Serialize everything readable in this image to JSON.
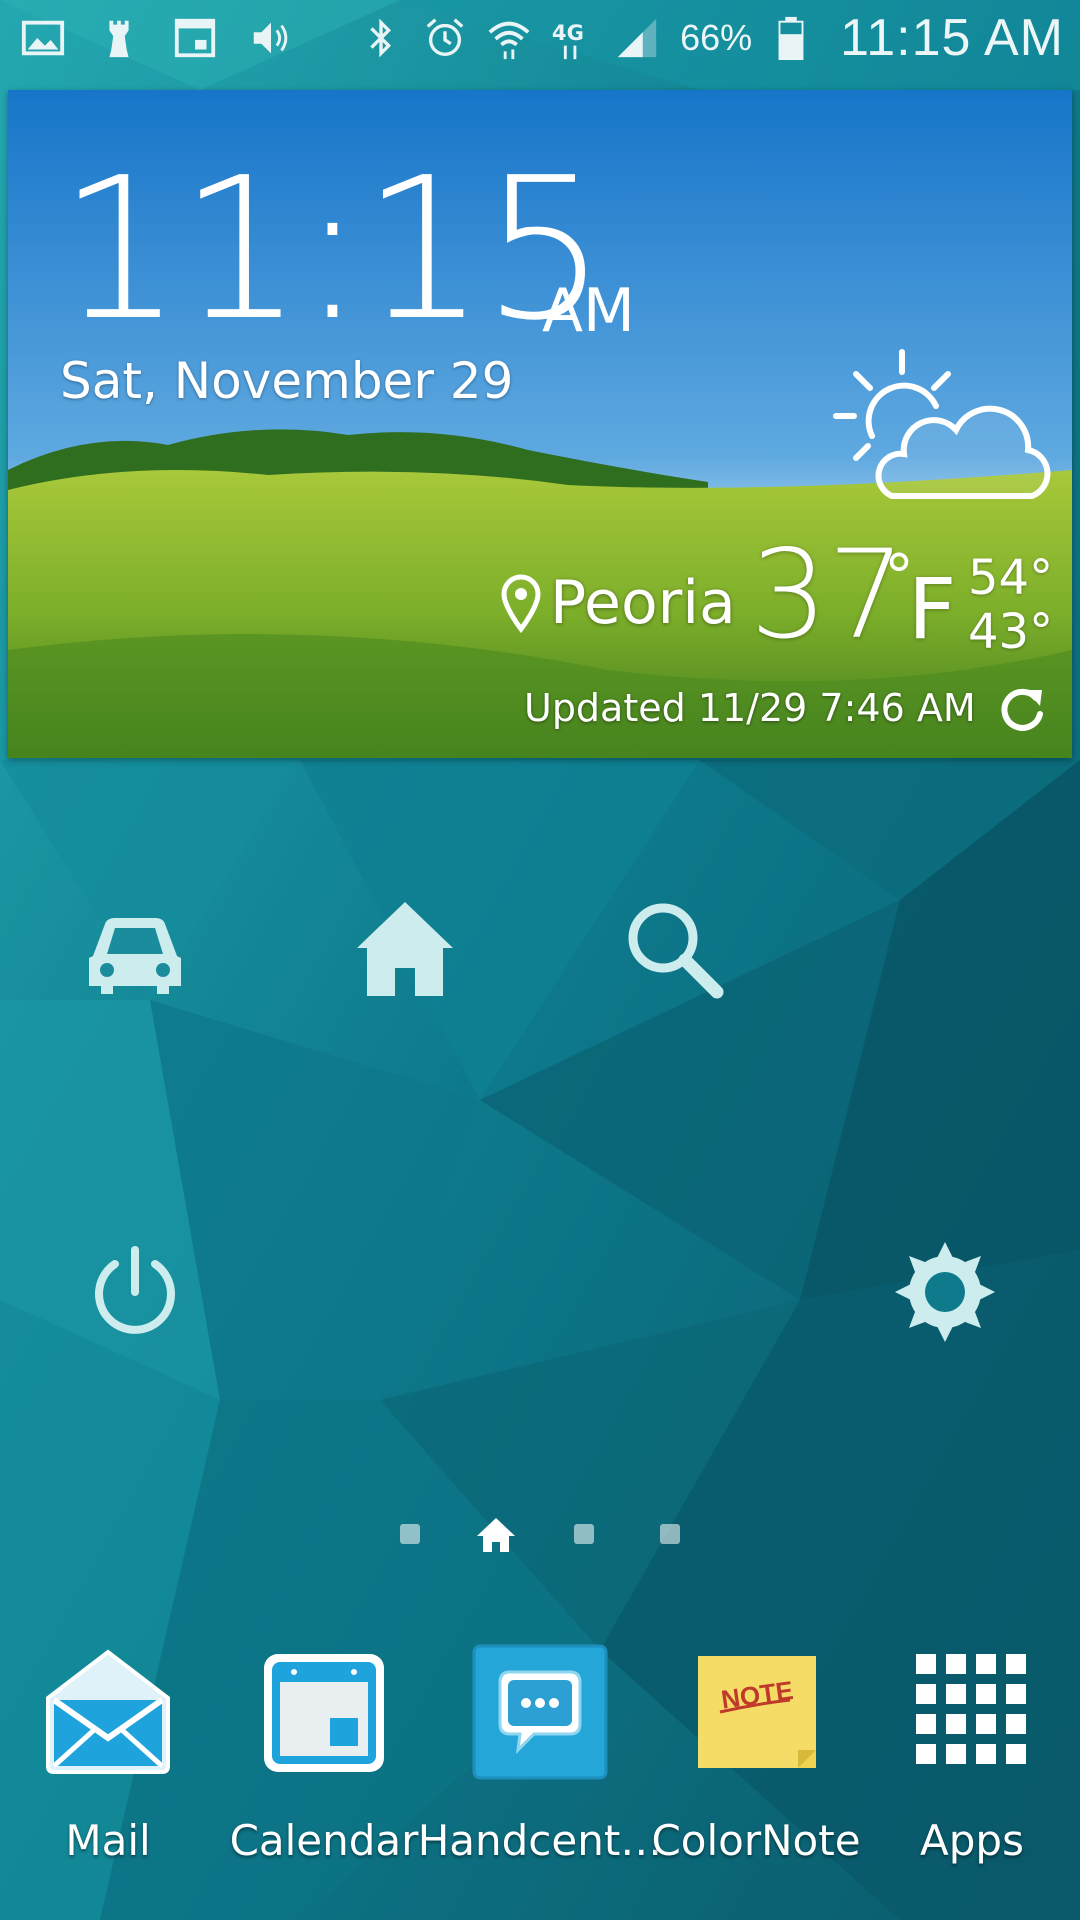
{
  "status_bar": {
    "left_icons": [
      "picture-icon",
      "chess-icon",
      "calendar-small-icon",
      "volume-icon"
    ],
    "right_icons": [
      "bluetooth-icon",
      "alarm-icon",
      "wifi-icon",
      "4g-lte-icon",
      "signal-icon",
      "battery-icon"
    ],
    "battery_percent": "66%",
    "time": "11:15 AM"
  },
  "clock_widget": {
    "time": "11:15",
    "ampm": "AM",
    "date": "Sat, November 29"
  },
  "weather": {
    "icon": "partly-cloudy-icon",
    "location": "Peoria",
    "temperature": "37",
    "degree_symbol": "°",
    "unit": "F",
    "high": "54°",
    "low": "43°",
    "updated": "Updated 11/29 7:46 AM"
  },
  "shortcuts": [
    "car-icon",
    "home-icon",
    "search-icon",
    "power-icon",
    "settings-icon"
  ],
  "pager": {
    "pages": 4,
    "current": 1
  },
  "dock": [
    {
      "label": "Mail",
      "icon": "mail-icon"
    },
    {
      "label": "Calendar",
      "icon": "calendar-icon"
    },
    {
      "label": "Handcent…",
      "icon": "handcent-icon"
    },
    {
      "label": "ColorNote",
      "icon": "colornote-icon",
      "note_text": "NOTE"
    },
    {
      "label": "Apps",
      "icon": "apps-grid-icon"
    }
  ],
  "colors": {
    "wallpaper_dark": "#0a5b6b",
    "wallpaper_light": "#1a9aa6",
    "sky": "#1d82cf",
    "grass": "#7fb52c",
    "mail_blue": "#1ea3dc",
    "note_yellow": "#f4d95c"
  }
}
